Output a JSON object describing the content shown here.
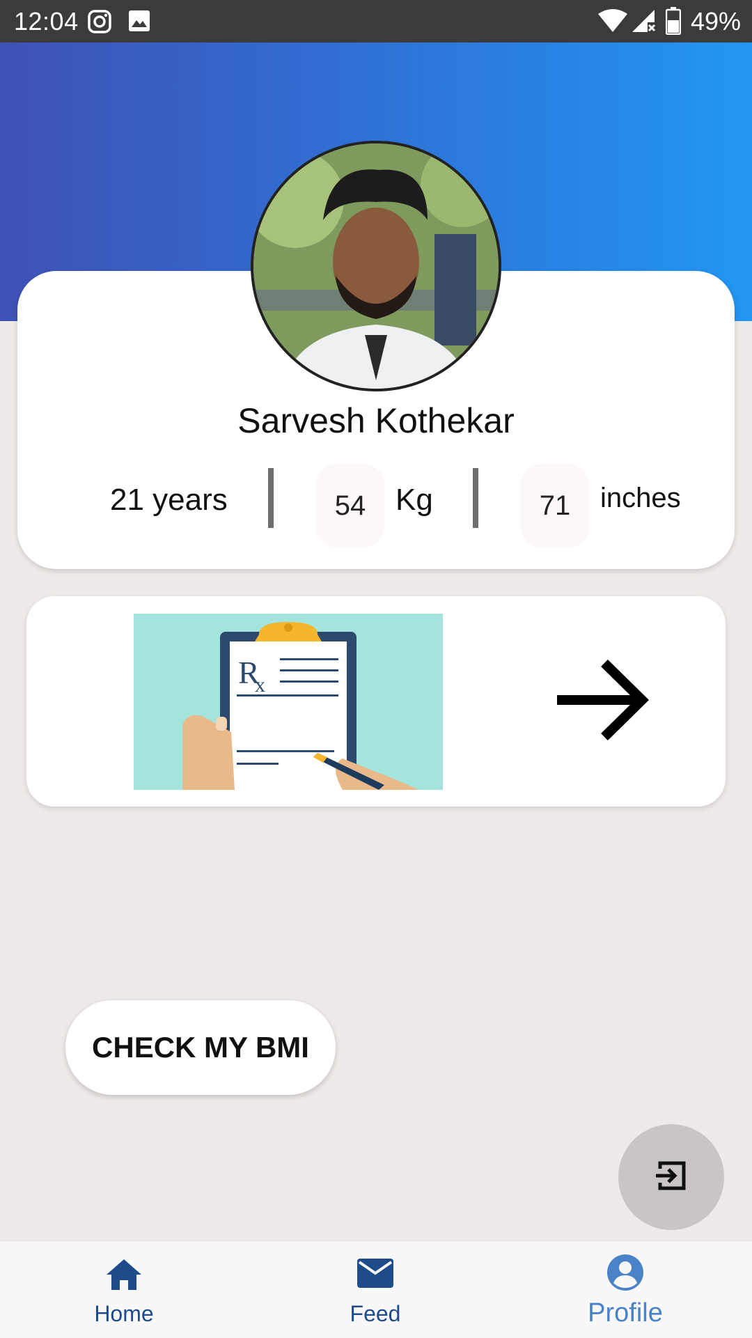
{
  "status_bar": {
    "time": "12:04",
    "battery": "49%"
  },
  "profile": {
    "name": "Sarvesh Kothekar",
    "age_text": "21 years",
    "weight_value": "54",
    "weight_unit": "Kg",
    "height_value": "71",
    "height_unit": "inches"
  },
  "actions": {
    "bmi_label": "CHECK MY BMI"
  },
  "bottom_nav": {
    "items": [
      {
        "label": "Home",
        "icon": "home-icon"
      },
      {
        "label": "Feed",
        "icon": "mail-icon"
      },
      {
        "label": "Profile",
        "icon": "account-circle-icon",
        "active": true
      }
    ]
  },
  "colors": {
    "header_start": "#3f51b5",
    "header_end": "#2196f3",
    "nav_active": "#4a82c8",
    "nav_inactive": "#1e4b8a"
  }
}
